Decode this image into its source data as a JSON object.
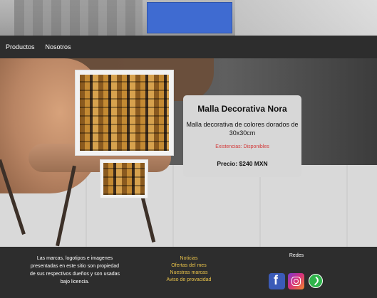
{
  "nav": {
    "items": [
      "Productos",
      "Nosotros"
    ]
  },
  "product": {
    "title": "Malla Decorativa Nora",
    "description": "Malla decorativa de colores dorados de 30x30cm",
    "stock": "Existencias: Disponibles",
    "price": "Precio: $240 MXN",
    "images": {
      "main_icon": "tile-image-icon",
      "thumb_icon": "tile-thumbnail-icon"
    }
  },
  "footer": {
    "legal": "Las marcas, logotipos e imagenes presentadas en este sitio son propiedad de sus respectivos dueños y son usadas bajo licencia.",
    "links": [
      "Noticias",
      "Ofertas del mes",
      "Nuestras marcas",
      "Aviso de provacidad"
    ],
    "social_title": "Redes",
    "social_icons": [
      "facebook-icon",
      "instagram-icon",
      "whatsapp-icon"
    ]
  },
  "colors": {
    "logo_blue": "#3f6bd1",
    "navbar_bg": "#2d2d2d",
    "card_bg": "#d7d7d7",
    "stock_red": "#d23a3a",
    "footer_link_gold": "#e8c24a"
  }
}
